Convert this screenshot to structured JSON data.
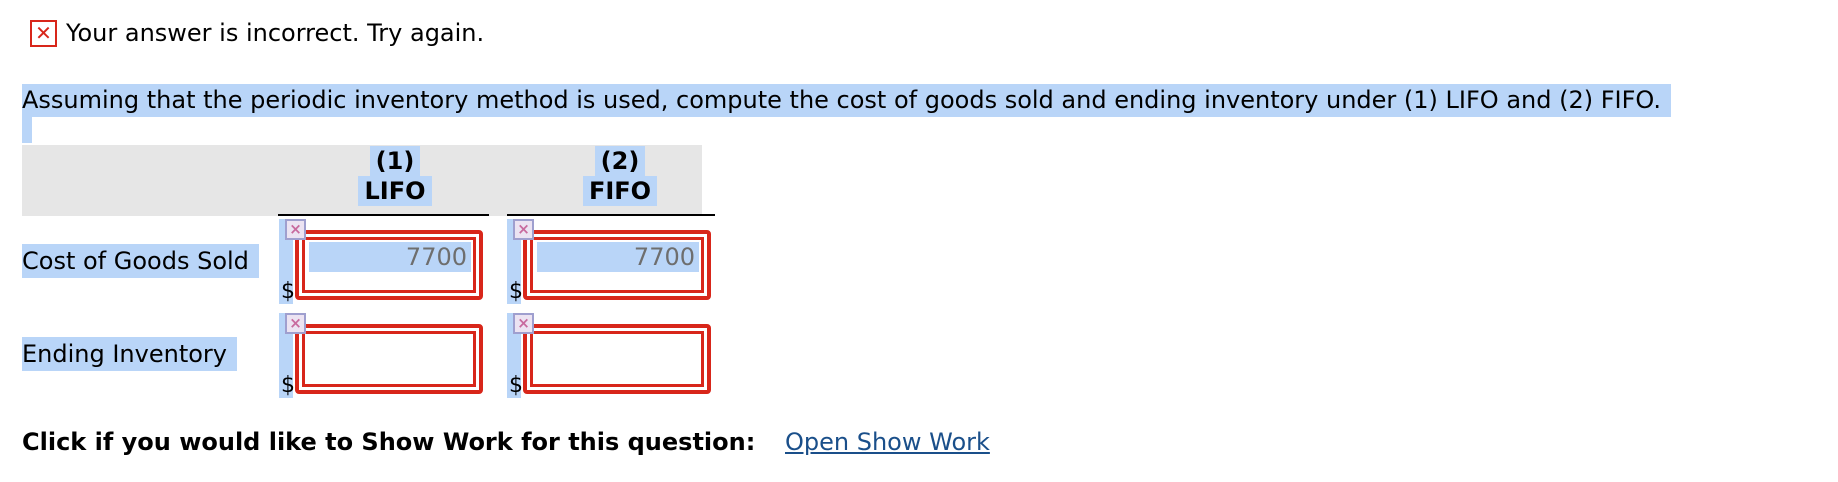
{
  "feedback": {
    "message": "Your answer is incorrect.  Try again.",
    "icon": "error-x-icon",
    "color": "#d8261a"
  },
  "question": {
    "text": "Assuming that the periodic inventory method is used, compute the cost of goods sold and ending inventory under (1) LIFO and (2) FIFO."
  },
  "table": {
    "columns": [
      {
        "number": "(1)",
        "label": "LIFO"
      },
      {
        "number": "(2)",
        "label": "FIFO"
      }
    ],
    "currency_symbol": "$",
    "rows": [
      {
        "label": "Cost of Goods Sold",
        "lifo_value": "7700",
        "fifo_value": "7700"
      },
      {
        "label": "Ending Inventory",
        "lifo_value": "",
        "fifo_value": ""
      }
    ]
  },
  "show_work": {
    "prompt": "Click if you would like to Show Work for this question:",
    "link_label": "Open Show Work"
  },
  "colors": {
    "selection": "#b9d5f8",
    "error_border": "#d8261a",
    "header_bg": "#e6e6e6",
    "link": "#1a4f8a"
  }
}
